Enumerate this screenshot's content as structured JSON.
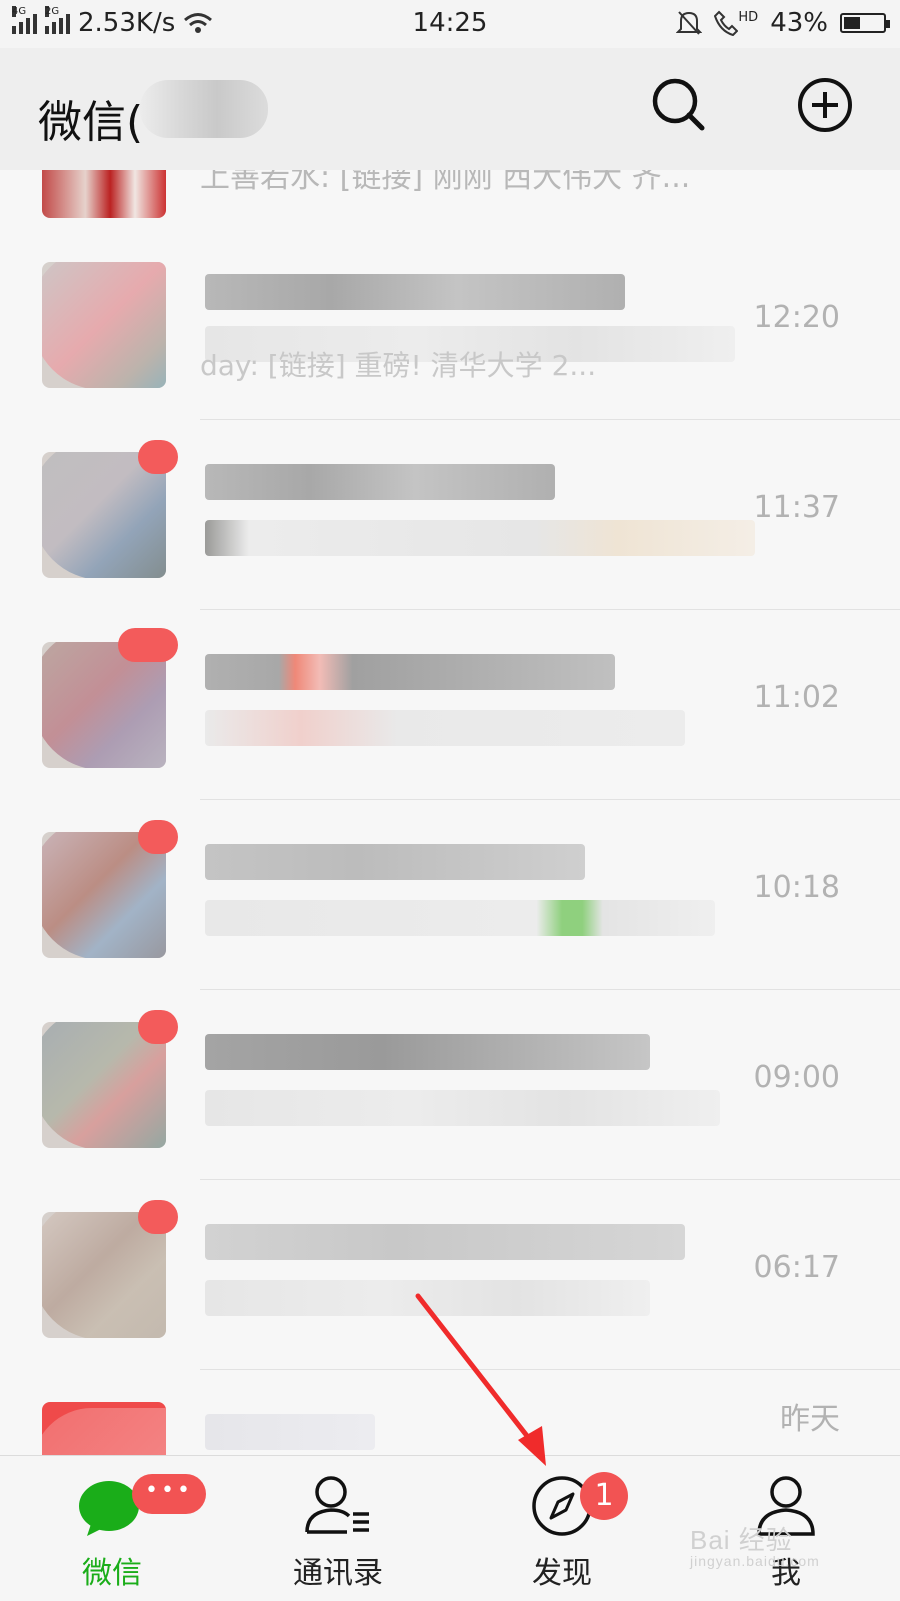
{
  "status_bar": {
    "net_label_1": "4G",
    "net_label_2": "2G",
    "speed": "2.53K/s",
    "time": "14:25",
    "hd_label": "HD",
    "battery": "43%",
    "battery_level": 0.43
  },
  "header": {
    "title": "微信(",
    "search_icon": "search-icon",
    "add_icon": "plus-circle-icon"
  },
  "chat_list": {
    "partial_top_preview": "上善若水: [链接] 刚刚 西大伟大 齐...",
    "row1_partial_preview": "day: [链接] 重磅! 清华大学 2...",
    "rows": [
      {
        "time": "12:20"
      },
      {
        "time": "11:37"
      },
      {
        "time": "11:02"
      },
      {
        "time": "10:18"
      },
      {
        "time": "09:00"
      },
      {
        "time": "06:17"
      },
      {
        "time": "昨天"
      }
    ]
  },
  "bottom_nav": {
    "tabs": [
      {
        "label": "微信",
        "icon": "chat-bubble-icon",
        "active": true,
        "badge": "•••"
      },
      {
        "label": "通讯录",
        "icon": "contacts-icon",
        "active": false
      },
      {
        "label": "发现",
        "icon": "compass-icon",
        "active": false,
        "badge": "1"
      },
      {
        "label": "我",
        "icon": "person-icon",
        "active": false
      }
    ]
  },
  "watermark": {
    "brand": "Bai 经验",
    "url": "jingyan.baidu.com"
  },
  "colors": {
    "accent_green": "#1aad19",
    "badge_red": "#f25353",
    "annotation_arrow": "#f02b2b"
  }
}
